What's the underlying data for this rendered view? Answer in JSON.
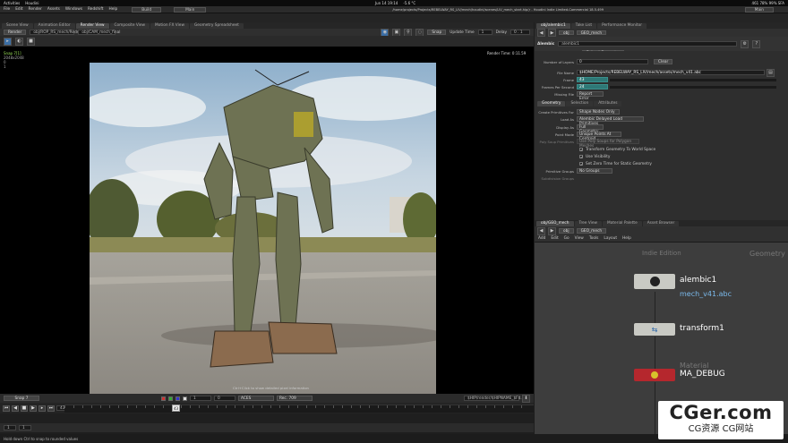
{
  "topbar": {
    "activities": "Activities",
    "app": "Houdini",
    "clock": "Jun 14  19:14",
    "weather": "-5.6 °C",
    "title": "/home/projects/Projects/REBELWAY_RS_LIV/mech/houdini/scenes/LIV_mech_start.hip(r - Houdini Indie Limited-Commercial 18.5.499",
    "right": "461  78%  99%  SFA"
  },
  "menu": {
    "items": [
      "File",
      "Edit",
      "Render",
      "Assets",
      "Windows",
      "Redshift",
      "Help"
    ],
    "build": "Build",
    "main": "Main",
    "main_right": "Main"
  },
  "left_tabs": [
    "Scene View",
    "Animation Editor",
    "Render View",
    "Composite View",
    "Motion FX View",
    "Geometry Spreadsheet"
  ],
  "left_tabs_active": 2,
  "viewport_bar": {
    "render_btn": "Render",
    "camera": "obj/ROP_RS_mech/Redshift_IPR",
    "node": "obj/CAM_mech_final",
    "snap_btn": "Snap",
    "update_time": "Update Time",
    "update_val": "1",
    "delay": "Delay",
    "delay_val": "0 . 1"
  },
  "viewport": {
    "snap": "Snap 7[1]",
    "res": "2048x2048",
    "c1": "0",
    "c2": "1",
    "render_time": "Render Time: 0:11.59",
    "click_info": "Ctrl+Click to show detailed pixel information"
  },
  "vp_bottom": {
    "snap7": "Snap 7",
    "num1": "1",
    "num2": "0",
    "aces": "ACES",
    "rec": "Rec. 709",
    "snap_path": "$HIP/render/$HIPNAME_$F4.$"
  },
  "timeline": {
    "frame": "43",
    "start": "1",
    "end": "1",
    "cursor": "43"
  },
  "status": "Hold down Ctrl to snap to rounded values",
  "right_tabs": [
    "obj/alembic1",
    "Take List",
    "Performance Monitor"
  ],
  "param_path": {
    "ctx": "obj",
    "node": "GEO_mech"
  },
  "node_header": {
    "type": "Alembic",
    "name": "alembic1",
    "reload": "Reload Geometry"
  },
  "params": {
    "layers_lbl": "Number of Layers",
    "layers_val": "0",
    "clear": "Clear",
    "filename_lbl": "File Name",
    "filename_val": "$HOME/Projects/REBELWAY_RS_LIV/mech/assets/mech_v41.abc",
    "frame_lbl": "Frame",
    "frame_val": "43",
    "fps_lbl": "Frames Per Second",
    "fps_val": "24",
    "missing_lbl": "Missing File",
    "missing_val": "Report Error"
  },
  "sub_tabs": [
    "Geometry",
    "Selection",
    "Attributes"
  ],
  "geo_params": [
    {
      "label": "Create Primitives For",
      "value": "Shape Nodes Only"
    },
    {
      "label": "Load As",
      "value": "Alembic Delayed Load Primitives"
    },
    {
      "label": "Display As",
      "value": "Full Geometry"
    },
    {
      "label": "Point Mode",
      "value": "Unique Points At Centroid"
    },
    {
      "label": "Poly Soup Primitives",
      "value": "Use Poly Soups for Polygon Meshes"
    }
  ],
  "checks": [
    "Transform Geometry To World Space",
    "Use Visibility",
    "Set Zero Time for Static Geometry"
  ],
  "prim_groups_lbl": "Primitive Groups",
  "prim_groups_val": "No Groups",
  "subdiv_lbl": "Subdivision Groups",
  "net_tabs": [
    "obj/GEO_mech",
    "Tree View",
    "Material Palette",
    "Asset Browser"
  ],
  "net_path": {
    "ctx": "obj",
    "node": "GEO_mech"
  },
  "net_menu": [
    "Add",
    "Edit",
    "Go",
    "View",
    "Tools",
    "Layout",
    "Help"
  ],
  "network": {
    "watermark_left": "Indie Edition",
    "watermark_right": "Geometry",
    "nodes": [
      {
        "name": "alembic1",
        "sub": "mech_v41.abc"
      },
      {
        "name": "transform1",
        "sub": ""
      },
      {
        "name": "MA_DEBUG",
        "sub": "Material"
      }
    ]
  },
  "watermark": {
    "title": "CGer.com",
    "sub": "CG资源  CG网站"
  },
  "colors": {
    "teal": "#2e7876",
    "debug_red": "#b5272d",
    "accent": "#3b6ea5"
  }
}
